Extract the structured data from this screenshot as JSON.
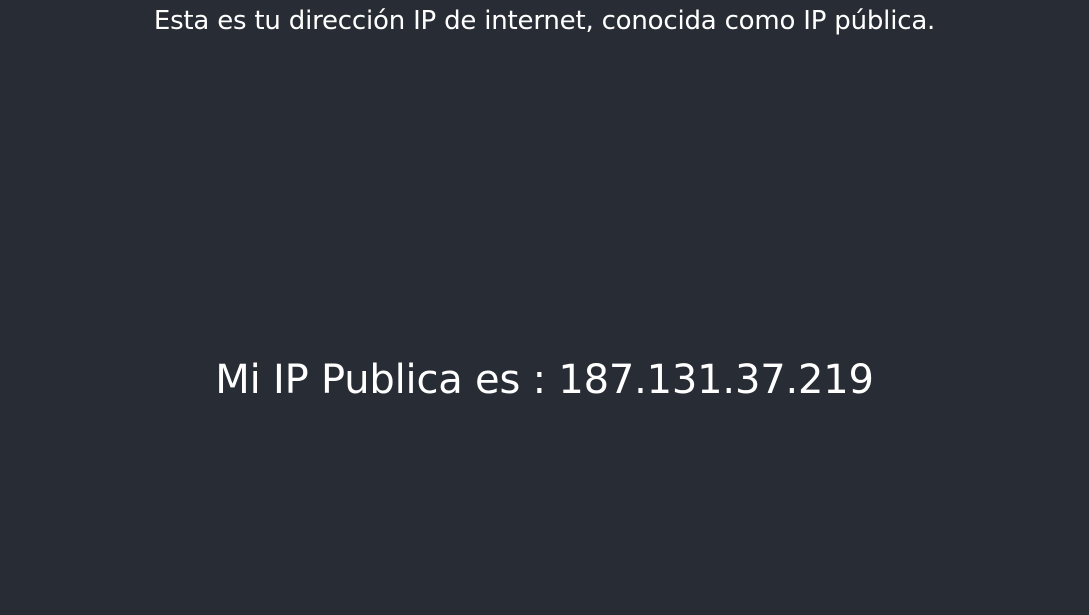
{
  "header": {
    "caption": "Esta es tu dirección IP de internet, conocida como IP pública."
  },
  "main": {
    "ip_label": "Mi IP Publica es :",
    "ip_address": "187.131.37.219"
  },
  "colors": {
    "background": "#282c34",
    "text": "#ffffff"
  }
}
